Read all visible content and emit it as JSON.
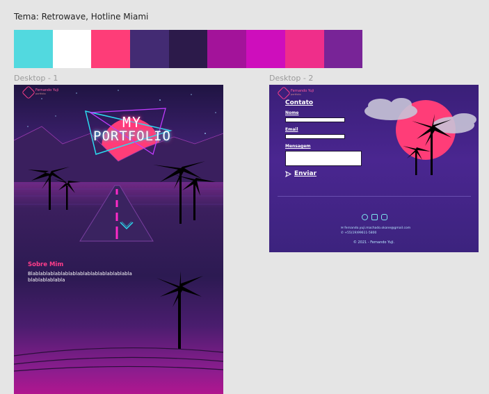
{
  "header": {
    "theme_title": "Tema: Retrowave, Hotline Miami"
  },
  "palette": [
    "#52d9df",
    "#ffffff",
    "#fe3d78",
    "#432b73",
    "#2c1a4a",
    "#a3139a",
    "#ce0ebc",
    "#ef2e8a",
    "#782497"
  ],
  "frames": {
    "desktop1": {
      "label": "Desktop - 1"
    },
    "desktop2": {
      "label": "Desktop - 2"
    }
  },
  "desktop1": {
    "logo": {
      "name": "Fernando Yuji",
      "subtitle": "portfolio"
    },
    "hero": {
      "line1": "MY",
      "line2": "PORTFOLIO"
    },
    "about": {
      "title": "Sobre Mim",
      "text": "Blablablablablablablablablablablablablablablablablablabla"
    }
  },
  "desktop2": {
    "logo": {
      "name": "Fernando Yuji",
      "subtitle": "portfolio"
    },
    "contact": {
      "title": "Contato",
      "name_label": "Nome",
      "email_label": "Email",
      "message_label": "Mensagem",
      "send_label": "Enviar"
    },
    "footer": {
      "socials": [
        "github-icon",
        "linkedin-icon",
        "instagram-icon"
      ],
      "email": "fernando.yuji.machado.okane@gmail.com",
      "phone": "+55(19)99611-5800",
      "copyright": "© 2021 - Fernando Yuji."
    }
  }
}
